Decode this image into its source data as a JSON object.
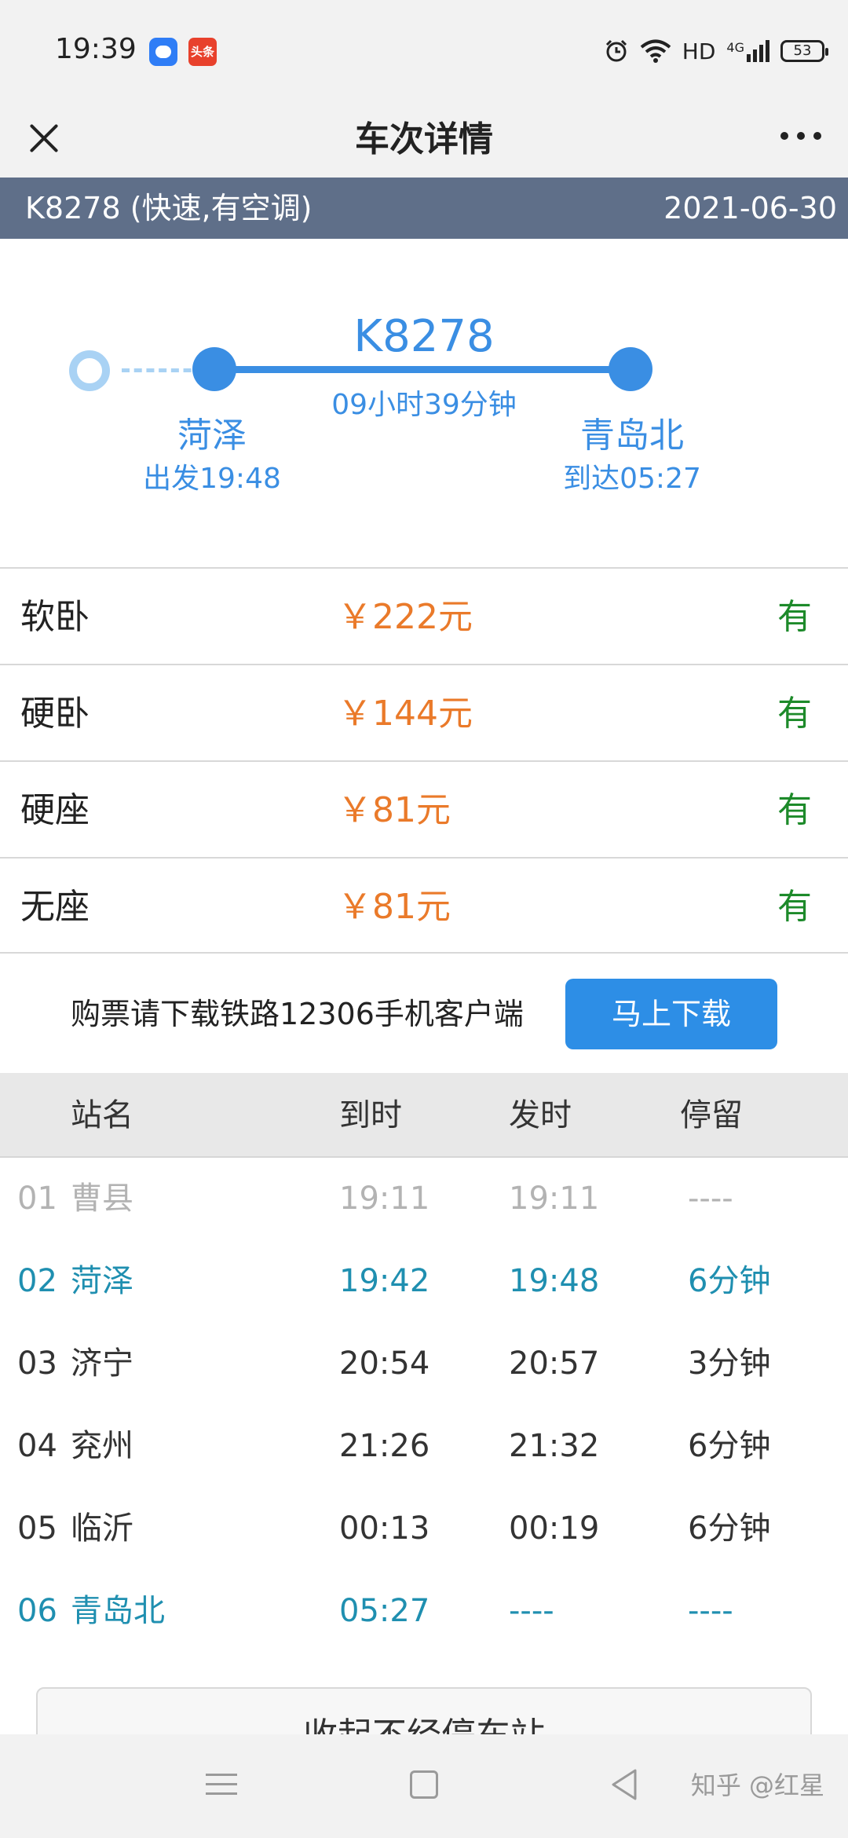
{
  "status_bar": {
    "time": "19:39",
    "app_icon_2_text": "头条",
    "network": "HD",
    "signal": "4G",
    "battery": "53"
  },
  "nav": {
    "title": "车次详情"
  },
  "train_strip": {
    "train_info": "K8278 (快速,有空调)",
    "date": "2021-06-30"
  },
  "journey": {
    "train_no": "K8278",
    "duration": "09小时39分钟",
    "from_station": "菏泽",
    "from_time": "出发19:48",
    "to_station": "青岛北",
    "to_time": "到达05:27"
  },
  "fares": [
    {
      "seat": "软卧",
      "price": "￥222元",
      "availability": "有"
    },
    {
      "seat": "硬卧",
      "price": "￥144元",
      "availability": "有"
    },
    {
      "seat": "硬座",
      "price": "￥81元",
      "availability": "有"
    },
    {
      "seat": "无座",
      "price": "￥81元",
      "availability": "有"
    }
  ],
  "download": {
    "text": "购票请下载铁路12306手机客户端",
    "button": "马上下载"
  },
  "table": {
    "headers": {
      "station": "站名",
      "arrive": "到时",
      "depart": "发时",
      "stay": "停留"
    },
    "rows": [
      {
        "no": "01",
        "name": "曹县",
        "arrive": "19:11",
        "depart": "19:11",
        "stay": "----"
      },
      {
        "no": "02",
        "name": "菏泽",
        "arrive": "19:42",
        "depart": "19:48",
        "stay": "6分钟"
      },
      {
        "no": "03",
        "name": "济宁",
        "arrive": "20:54",
        "depart": "20:57",
        "stay": "3分钟"
      },
      {
        "no": "04",
        "name": "兖州",
        "arrive": "21:26",
        "depart": "21:32",
        "stay": "6分钟"
      },
      {
        "no": "05",
        "name": "临沂",
        "arrive": "00:13",
        "depart": "00:19",
        "stay": "6分钟"
      },
      {
        "no": "06",
        "name": "青岛北",
        "arrive": "05:27",
        "depart": "----",
        "stay": "----"
      }
    ]
  },
  "collapse_button": "收起不经停车站",
  "watermark": "知乎 @红星",
  "colors": {
    "accent_blue": "#3a8ee3",
    "price_orange": "#ea7a2a",
    "available_green": "#1d8a2a",
    "highlight_teal": "#1f8fb0",
    "strip_gray": "#5f6f89"
  }
}
